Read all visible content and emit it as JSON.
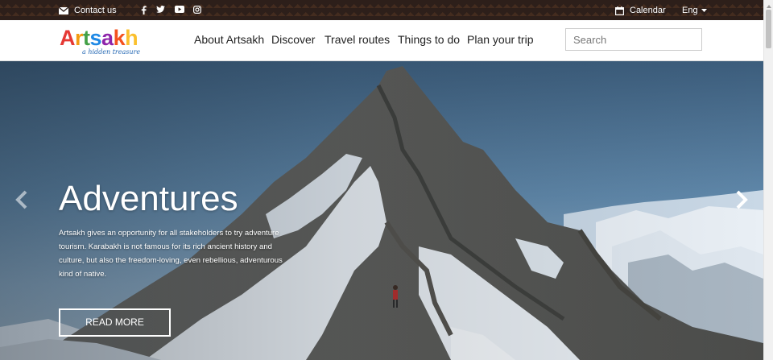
{
  "topbar": {
    "contact_label": "Contact us",
    "social_icons": [
      "facebook-icon",
      "twitter-icon",
      "youtube-icon",
      "instagram-icon"
    ],
    "calendar_label": "Calendar",
    "language": "Eng"
  },
  "brand": {
    "name": "Artsakh",
    "tagline": "a hidden treasure",
    "colors": [
      "#e53935",
      "#f39c12",
      "#43a047",
      "#1e88e5",
      "#8e24aa",
      "#f4511e",
      "#fbc02d"
    ]
  },
  "nav": {
    "items": [
      {
        "label": "About Artsakh"
      },
      {
        "label": "Discover"
      },
      {
        "label": "Travel routes"
      },
      {
        "label": "Things to do"
      },
      {
        "label": "Plan your trip"
      }
    ],
    "search_placeholder": "Search"
  },
  "hero": {
    "title": "Adventures",
    "text": "Artsakh gives an opportunity for all stakeholders to try adventure tourism. Karabakh is not famous for its rich ancient history and culture, but also the freedom-loving, even rebellious, adventurous kind of native.",
    "button_label": "READ MORE",
    "prev_icon": "chevron-left-icon",
    "next_icon": "chevron-right-icon"
  }
}
